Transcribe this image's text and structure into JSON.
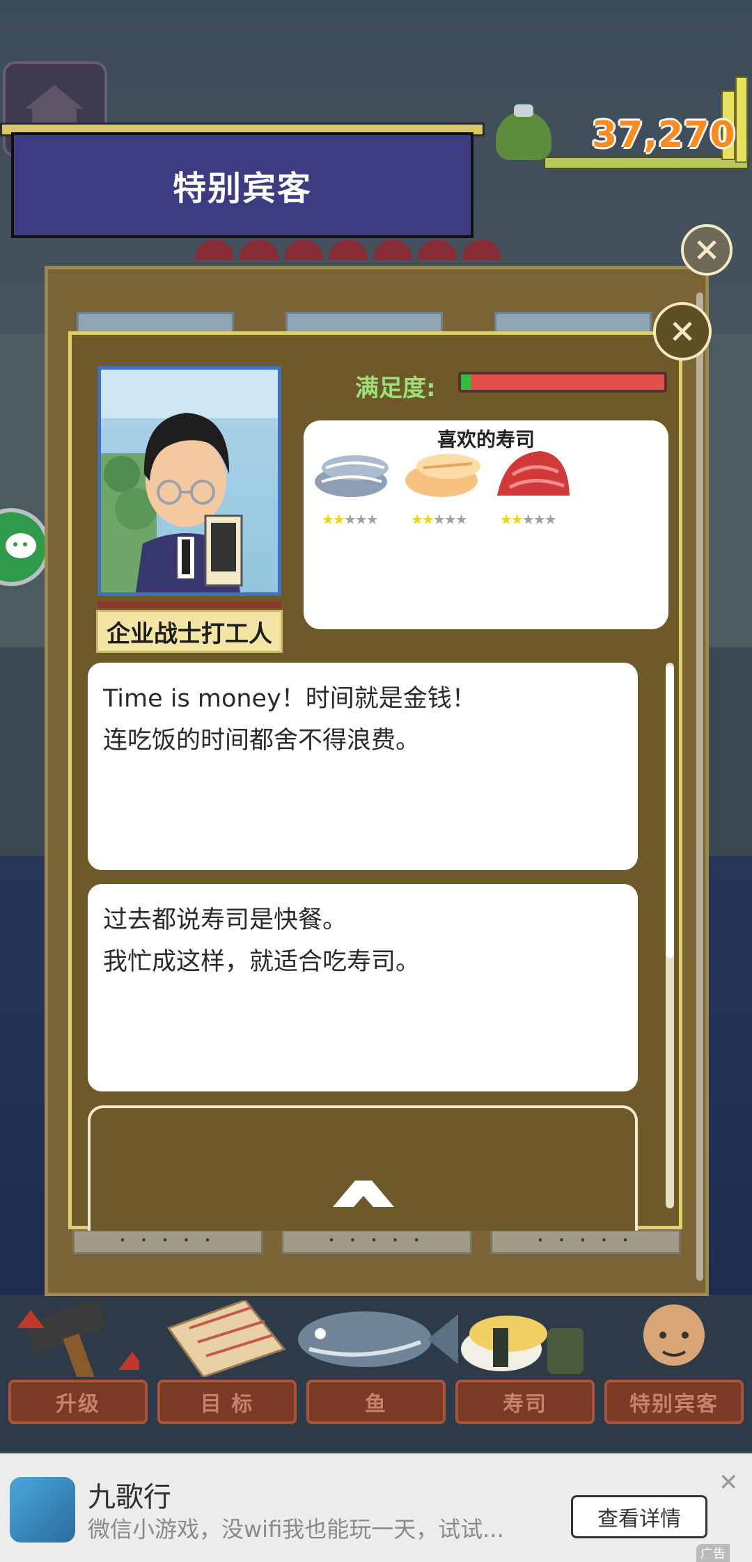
{
  "header": {
    "banner_title": "特别宾客",
    "money": "37,270"
  },
  "guest": {
    "name": "企业战士打工人",
    "satisfaction_label": "满足度:",
    "satisfaction_fraction": 0.02,
    "favorite_title": "喜欢的寿司",
    "favorites": [
      {
        "icon": "fish-sushi-icon",
        "stars": 2,
        "max_stars": 5
      },
      {
        "icon": "egg-sushi-icon",
        "stars": 2,
        "max_stars": 5
      },
      {
        "icon": "tuna-sushi-icon",
        "stars": 2,
        "max_stars": 5
      }
    ],
    "dialog_1": [
      "Time is money！时间就是金钱！",
      "连吃饭的时间都舍不得浪费。"
    ],
    "dialog_2": [
      "过去都说寿司是快餐。",
      "我忙成这样，就适合吃寿司。"
    ],
    "tab_dots": "• • • • •"
  },
  "nav": [
    {
      "label": "升级",
      "icon": "hammer-icon"
    },
    {
      "label": "目 标",
      "icon": "target-board-icon"
    },
    {
      "label": "鱼",
      "icon": "fish-icon"
    },
    {
      "label": "寿司",
      "icon": "sushi-icon"
    },
    {
      "label": "特别宾客",
      "icon": "guest-icon"
    }
  ],
  "ad": {
    "title": "九歌行",
    "description": "微信小游戏，没wifi我也能玩一天，试试...",
    "button": "查看详情",
    "label": "广告"
  },
  "colors": {
    "banner": "#3d3c82",
    "money": "#ff8a1d",
    "panel": "#6e5929",
    "satisfaction_fill": "#e4504a",
    "satisfaction_label": "#9be07b"
  }
}
